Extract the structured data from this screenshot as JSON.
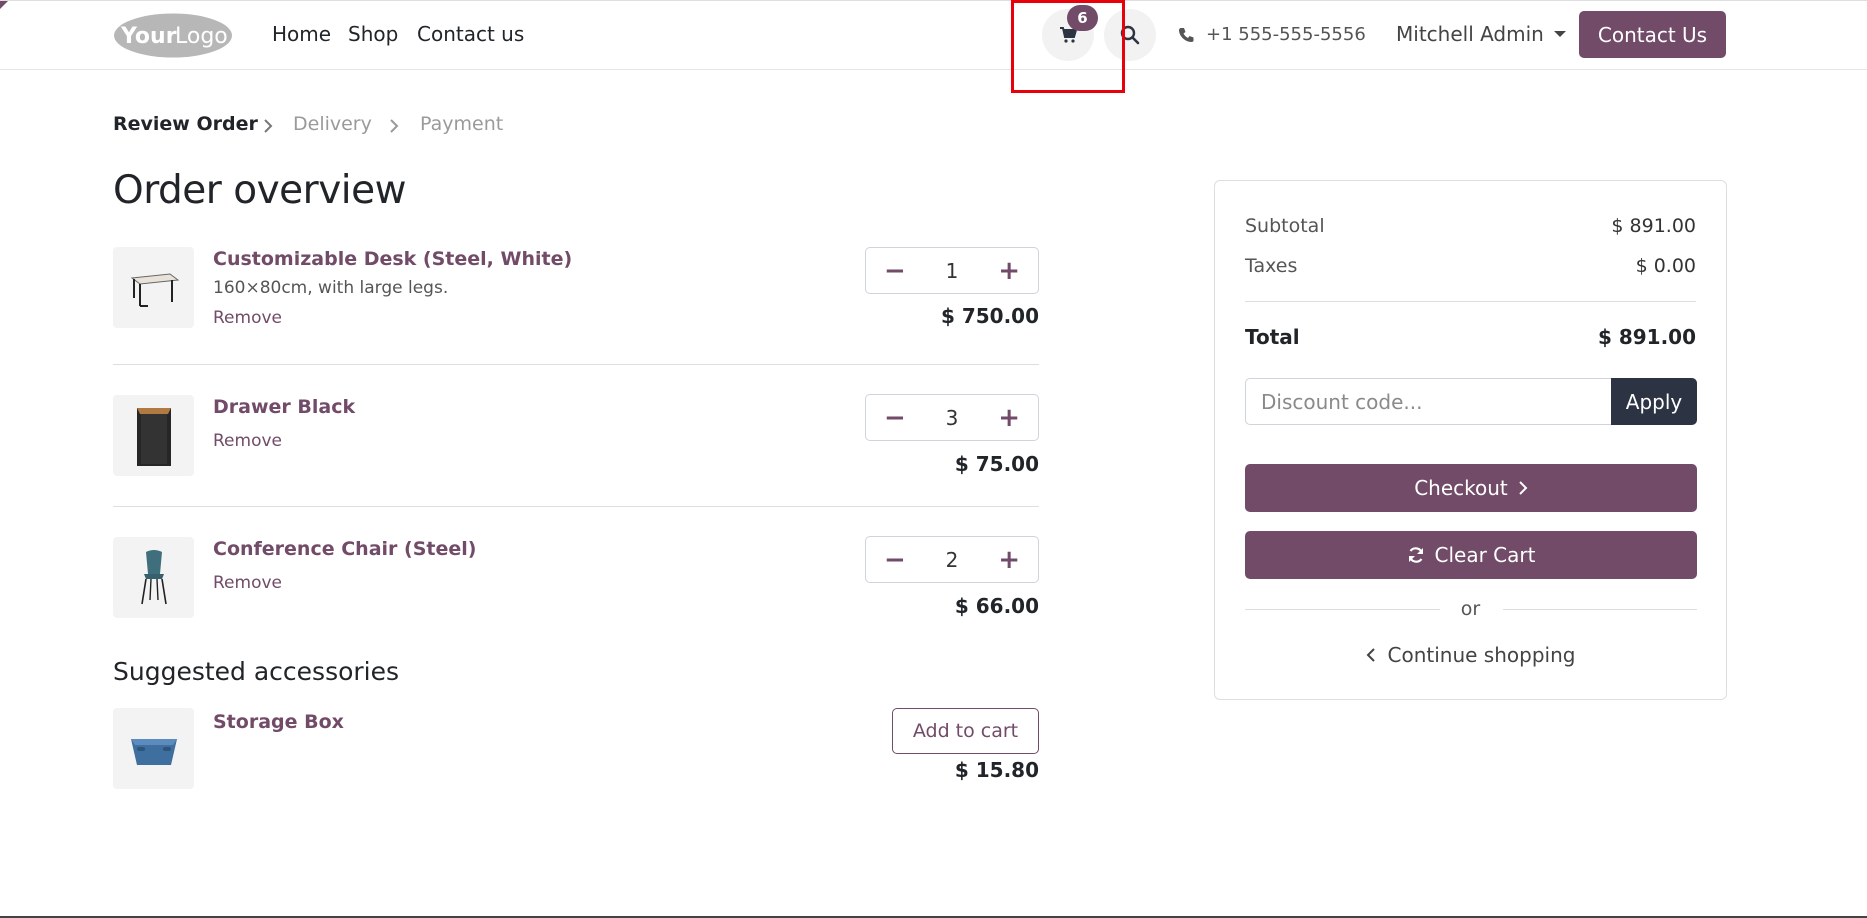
{
  "header": {
    "logo_text": "YourLogo",
    "nav": [
      "Home",
      "Shop",
      "Contact us"
    ],
    "cart_count": "6",
    "phone": "+1 555-555-5556",
    "user": "Mitchell Admin",
    "contact_button": "Contact Us"
  },
  "breadcrumb": [
    "Review Order",
    "Delivery",
    "Payment"
  ],
  "page_title": "Order overview",
  "items": [
    {
      "name": "Customizable Desk (Steel, White)",
      "desc": "160×80cm, with large legs.",
      "remove": "Remove",
      "qty": "1",
      "price": "$ 750.00"
    },
    {
      "name": "Drawer Black",
      "remove": "Remove",
      "qty": "3",
      "price": "$ 75.00"
    },
    {
      "name": "Conference Chair (Steel)",
      "remove": "Remove",
      "qty": "2",
      "price": "$ 66.00"
    }
  ],
  "suggested": {
    "title": "Suggested accessories",
    "items": [
      {
        "name": "Storage Box",
        "button": "Add to cart",
        "price": "$ 15.80"
      }
    ]
  },
  "summary": {
    "subtotal_label": "Subtotal",
    "subtotal": "$ 891.00",
    "taxes_label": "Taxes",
    "taxes": "$ 0.00",
    "total_label": "Total",
    "total": "$ 891.00",
    "discount_placeholder": "Discount code...",
    "apply": "Apply",
    "checkout": "Checkout",
    "clear_cart": "Clear Cart",
    "or": "or",
    "continue": "Continue shopping"
  },
  "colors": {
    "brand": "#714B67",
    "dark": "#2c3444",
    "highlight": "#e8000b"
  }
}
